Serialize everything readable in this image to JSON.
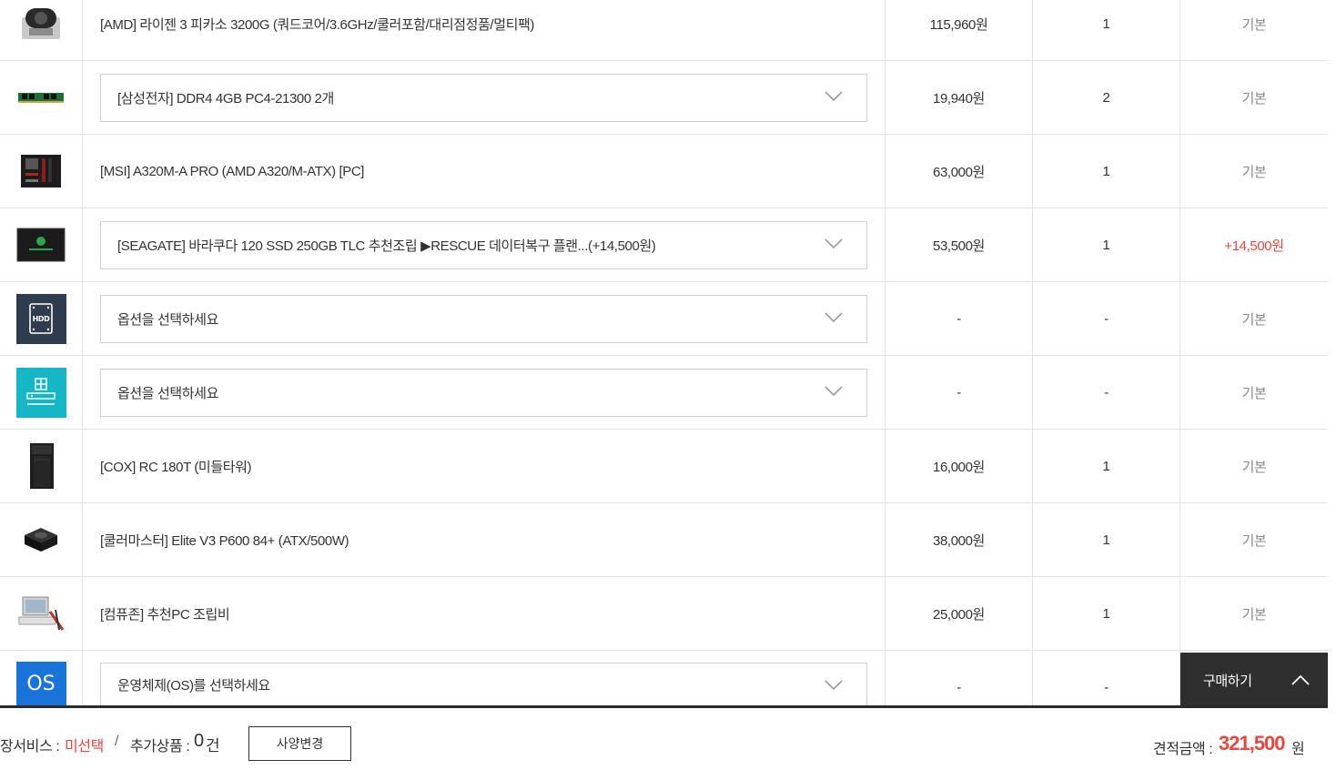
{
  "rows": [
    {
      "name": "[AMD] 라이젠 3 피카소 3200G (쿼드코어/3.6GHz/쿨러포함/대리점정품/멀티팩)",
      "price": "115,960원",
      "qty": "1",
      "base": "기본"
    },
    {
      "name": "[삼성전자] DDR4 4GB PC4-21300 2개",
      "price": "19,940원",
      "qty": "2",
      "base": "기본"
    },
    {
      "name": "[MSI] A320M-A PRO (AMD A320/M-ATX) [PC]",
      "price": "63,000원",
      "qty": "1",
      "base": "기본"
    },
    {
      "name": "[SEAGATE] 바라쿠다 120 SSD 250GB TLC 추천조립 ▶RESCUE 데이터복구 플랜...(+14,500원)",
      "price": "53,500원",
      "qty": "1",
      "base": "+14,500원",
      "base_color": "#e8463f"
    },
    {
      "name": "옵션을 선택하세요",
      "price": "-",
      "qty": "-",
      "base": "기본",
      "icon_text": "HDD"
    },
    {
      "name": "옵션을 선택하세요",
      "price": "-",
      "qty": "-",
      "base": "기본"
    },
    {
      "name": "[COX] RC 180T (미들타워)",
      "price": "16,000원",
      "qty": "1",
      "base": "기본"
    },
    {
      "name": "[쿨러마스터] Elite V3 P600 84+ (ATX/500W)",
      "price": "38,000원",
      "qty": "1",
      "base": "기본"
    },
    {
      "name": "[컴퓨존] 추천PC 조립비",
      "price": "25,000원",
      "qty": "1",
      "base": "기본"
    },
    {
      "name": "운영체제(OS)를 선택하세요",
      "price": "-",
      "qty": "-",
      "base": "",
      "icon_text": "OS"
    }
  ],
  "icons": [
    "cpu-icon",
    "ram-icon",
    "motherboard-icon",
    "ssd-icon",
    "hdd-icon",
    "odd-icon",
    "case-icon",
    "power-supply-icon",
    "assembly-service-icon",
    "os-icon"
  ],
  "buy_tab": {
    "label": "구매하기"
  },
  "bottom": {
    "service_label": "장서비스 : ",
    "service_value": "미선택",
    "separator": "/",
    "extra_label": "추가상품 : ",
    "extra_count": "0",
    "extra_unit": "건",
    "spec_button": "사양변경",
    "total_label": "견적금액 : ",
    "total_value": "321,500",
    "total_unit": "원"
  },
  "colors": {
    "accent_red": "#e8463f",
    "dark": "#2f2f2f",
    "os_blue": "#1a73d9",
    "odd_teal": "#15b6c6",
    "hdd_navy": "#2f3c4d"
  }
}
